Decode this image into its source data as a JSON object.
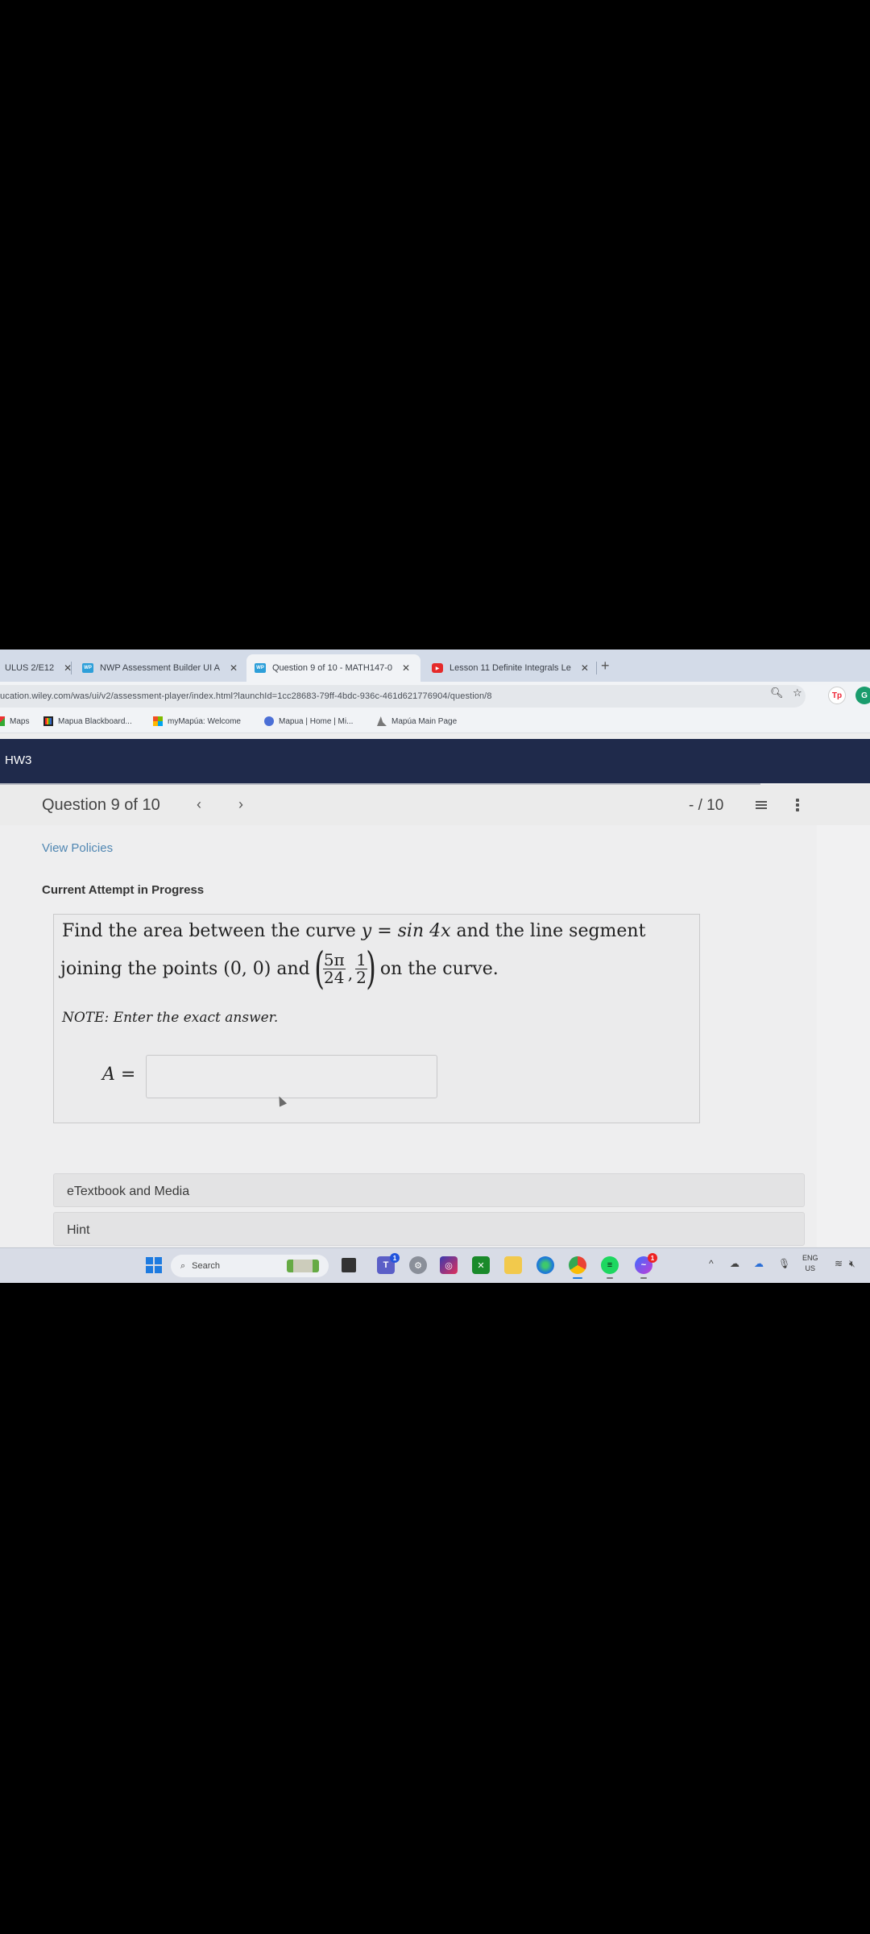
{
  "browser": {
    "tabs": [
      {
        "label": "ULUS 2/E12",
        "icon": "generic",
        "active": false
      },
      {
        "label": "NWP Assessment Builder UI A",
        "icon": "wiley-wp-icon",
        "active": false
      },
      {
        "label": "Question 9 of 10 - MATH147-0",
        "icon": "wiley-wp-icon",
        "active": true
      },
      {
        "label": "Lesson 11 Definite Integrals Le",
        "icon": "youtube-icon",
        "active": false
      }
    ],
    "close_glyph": "✕",
    "new_tab_glyph": "+",
    "url": "ucation.wiley.com/was/ui/v2/assessment-player/index.html?launchId=1cc28683-79ff-4bdc-936c-461d621776904/question/8",
    "extensions": [
      "Tp",
      "G"
    ],
    "bookmarks": [
      {
        "label": "Maps",
        "icon": "maps-icon"
      },
      {
        "label": "Mapua Blackboard...",
        "icon": "blackboard-icon"
      },
      {
        "label": "myMapúa: Welcome",
        "icon": "microsoft-icon"
      },
      {
        "label": "Mapua | Home | Mi...",
        "icon": "mapua-home-icon"
      },
      {
        "label": "Mapúa Main Page",
        "icon": "mapua-main-icon"
      }
    ]
  },
  "app": {
    "title": "HW3",
    "question_nav": {
      "title": "Question 9 of 10",
      "prev_glyph": "‹",
      "next_glyph": "›",
      "score": "- / 10"
    },
    "view_policies": "View Policies",
    "attempt_status": "Current Attempt in Progress",
    "question": {
      "line1_pre": "Find the area between the curve ",
      "line1_math": "y = sin 4x",
      "line1_post": " and the line segment",
      "line2_pre": "joining the points ",
      "point1": "(0, 0)",
      "and": " and ",
      "point2_num1": "5π",
      "point2_den1": "24",
      "point2_num2": "1",
      "point2_den2": "2",
      "line2_post": " on the curve.",
      "note": "NOTE: Enter the exact answer.",
      "answer_label": "A =",
      "answer_value": ""
    },
    "accordions": [
      {
        "label": "eTextbook and Media"
      },
      {
        "label": "Hint"
      }
    ]
  },
  "taskbar": {
    "search_placeholder": "Search",
    "teams_badge": "1",
    "messenger_badge": "1",
    "lang_line1": "ENG",
    "lang_line2": "US"
  },
  "colors": {
    "header_bg": "#1f2a4b",
    "link": "#4f86b2",
    "tab_strip": "#d3dbe8"
  }
}
